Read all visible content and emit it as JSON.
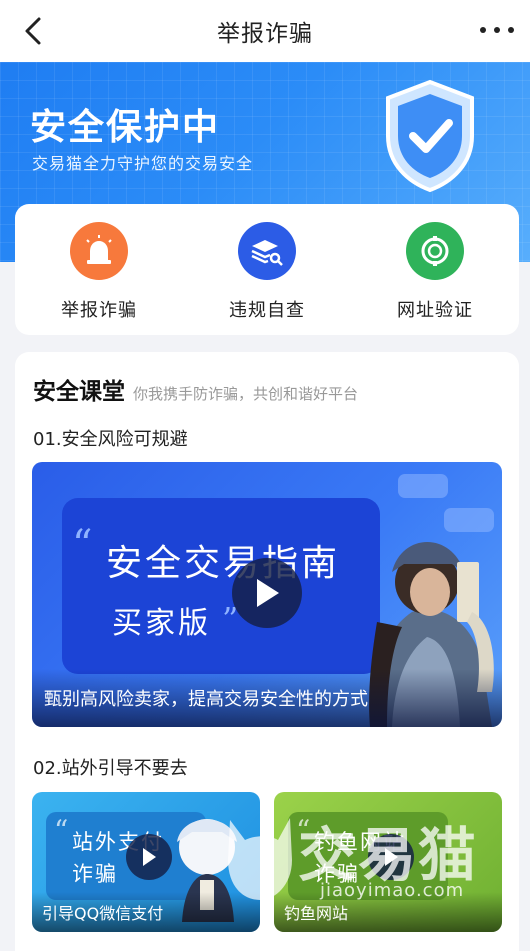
{
  "nav": {
    "title": "举报诈骗"
  },
  "hero": {
    "title": "安全保护中",
    "subtitle": "交易猫全力守护您的交易安全"
  },
  "quick_actions": [
    {
      "label": "举报诈骗",
      "icon": "alarm-icon",
      "color": "#f7793c"
    },
    {
      "label": "违规自查",
      "icon": "layers-search-icon",
      "color": "#2c5ce6"
    },
    {
      "label": "网址验证",
      "icon": "link-verify-icon",
      "color": "#2fb35a"
    }
  ],
  "safety_class": {
    "title": "安全课堂",
    "subtitle": "你我携手防诈骗，共创和谐好平台",
    "lesson1": {
      "title": "01.安全风险可规避",
      "video": {
        "main_text": "安全交易指南",
        "sub_text": "买家版",
        "caption": "甄别高风险卖家，提高交易安全性的方式"
      }
    },
    "lesson2": {
      "title": "02.站外引导不要去",
      "videos": [
        {
          "line1": "站外支付",
          "line2": "诈骗",
          "caption": "引导QQ微信支付",
          "bg": "#29a3ea"
        },
        {
          "line1": "钓鱼网站",
          "line2": "诈骗",
          "caption": "钓鱼网站",
          "bg": "#8cc83e"
        }
      ]
    }
  },
  "watermark": {
    "text": "交易猫",
    "url": "jiaoyimao.com"
  }
}
